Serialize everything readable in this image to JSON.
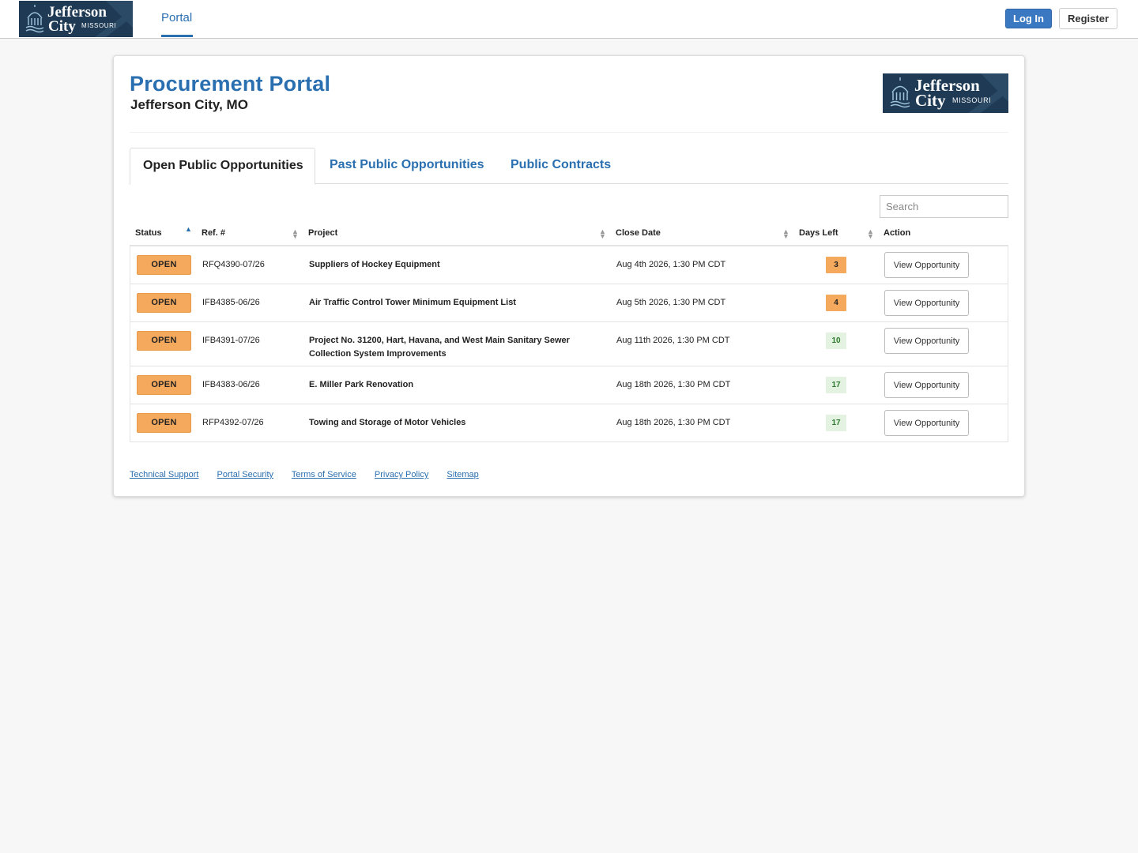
{
  "nav": {
    "logo": {
      "line1": "Jefferson",
      "line2": "City",
      "line3": "MISSOURI"
    },
    "links": [
      {
        "label": "Portal"
      }
    ],
    "login_label": "Log In",
    "register_label": "Register"
  },
  "header": {
    "title": "Procurement Portal",
    "subtitle": "Jefferson City, MO"
  },
  "tabs": [
    {
      "label": "Open Public Opportunities",
      "active": true
    },
    {
      "label": "Past Public Opportunities",
      "active": false
    },
    {
      "label": "Public Contracts",
      "active": false
    }
  ],
  "search": {
    "placeholder": "Search"
  },
  "table": {
    "columns": [
      "Status",
      "Ref. #",
      "Project",
      "Close Date",
      "Days Left",
      "Action"
    ],
    "rows": [
      {
        "status": "OPEN",
        "ref": "RFQ4390-07/26",
        "project": "Suppliers of Hockey Equipment",
        "close": "Aug 4th 2026, 1:30 PM CDT",
        "days": "3",
        "action": "View Opportunity"
      },
      {
        "status": "OPEN",
        "ref": "IFB4385-06/26",
        "project": "Air Traffic Control Tower Minimum Equipment List",
        "close": "Aug 5th 2026, 1:30 PM CDT",
        "days": "4",
        "action": "View Opportunity"
      },
      {
        "status": "OPEN",
        "ref": "IFB4391-07/26",
        "project": "Project No. 31200, Hart, Havana, and West Main Sanitary Sewer Collection System Improvements",
        "close": "Aug 11th 2026, 1:30 PM CDT",
        "days": "10",
        "action": "View Opportunity"
      },
      {
        "status": "OPEN",
        "ref": "IFB4383-06/26",
        "project": "E. Miller Park Renovation",
        "close": "Aug 18th 2026, 1:30 PM CDT",
        "days": "17",
        "action": "View Opportunity"
      },
      {
        "status": "OPEN",
        "ref": "RFP4392-07/26",
        "project": "Towing and Storage of Motor Vehicles",
        "close": "Aug 18th 2026, 1:30 PM CDT",
        "days": "17",
        "action": "View Opportunity"
      }
    ]
  },
  "footer": {
    "links": [
      "Technical Support",
      "Portal Security",
      "Terms of Service",
      "Privacy Policy",
      "Sitemap"
    ]
  },
  "colors": {
    "brand_blue": "#2a6fb0",
    "open_orange": "#f5a95d",
    "days_green": "#e4f2e1",
    "logo_navy": "#1e3a54"
  }
}
